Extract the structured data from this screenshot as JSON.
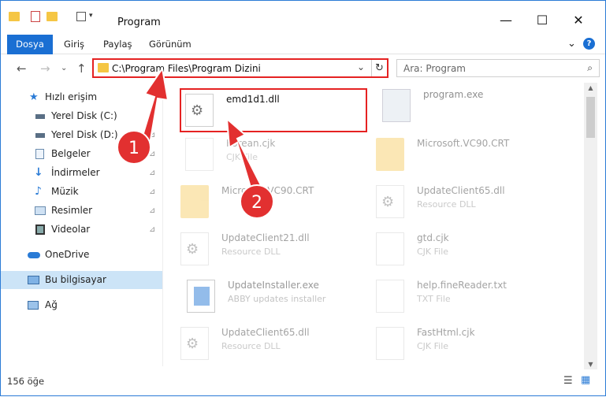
{
  "window": {
    "title": "Program",
    "minimize_glyph": "—",
    "maximize_glyph": "☐",
    "close_glyph": "✕"
  },
  "ribbon": {
    "tabs": [
      "Dosya",
      "Giriş",
      "Paylaş",
      "Görünüm"
    ],
    "expand_glyph": "⌄",
    "help_glyph": "?"
  },
  "address": {
    "path": "C:\\Program Files\\Program Dizini",
    "back_glyph": "←",
    "forward_glyph": "→",
    "recent_glyph": "⌄",
    "up_glyph": "↑",
    "dropdown_glyph": "⌄",
    "refresh_glyph": "↻"
  },
  "search": {
    "placeholder": "Ara: Program",
    "icon_glyph": "⌕"
  },
  "nav": {
    "quick_access": "Hızlı erişim",
    "items": [
      {
        "label": "Yerel Disk (C:)",
        "icon": "drive-icon"
      },
      {
        "label": "Yerel Disk (D:)",
        "icon": "drive-icon"
      },
      {
        "label": "Belgeler",
        "icon": "documents-icon"
      },
      {
        "label": "İndirmeler",
        "icon": "downloads-icon"
      },
      {
        "label": "Müzik",
        "icon": "music-icon"
      },
      {
        "label": "Resimler",
        "icon": "pictures-icon"
      },
      {
        "label": "Videolar",
        "icon": "videos-icon"
      }
    ],
    "onedrive": "OneDrive",
    "this_pc": "Bu bilgisayar",
    "network": "Ağ",
    "pin_glyph": "⊿"
  },
  "files": [
    {
      "name": "emd1d1.dll",
      "sub": "",
      "kind": "dll"
    },
    {
      "name": "program.exe",
      "sub": "",
      "kind": "exe"
    },
    {
      "name": "Korean.cjk",
      "sub": "CJK File",
      "kind": "doc"
    },
    {
      "name": "Microsoft.VC90.CRT",
      "sub": "",
      "kind": "folder"
    },
    {
      "name": "Microsoft.VC90.CRT",
      "sub": "",
      "kind": "folder"
    },
    {
      "name": "UpdateClient65.dll",
      "sub": "Resource DLL",
      "kind": "dll"
    },
    {
      "name": "UpdateClient21.dll",
      "sub": "Resource DLL",
      "kind": "dll"
    },
    {
      "name": "gtd.cjk",
      "sub": "CJK File",
      "kind": "doc"
    },
    {
      "name": "UpdateInstaller.exe",
      "sub": "ABBY updates installer",
      "kind": "exe"
    },
    {
      "name": "help.fineReader.txt",
      "sub": "TXT File",
      "kind": "doc"
    },
    {
      "name": "UpdateClient65.dll",
      "sub": "Resource DLL",
      "kind": "dll"
    },
    {
      "name": "FastHtml.cjk",
      "sub": "CJK File",
      "kind": "doc"
    }
  ],
  "scrollbar": {
    "up_glyph": "▲",
    "down_glyph": "▼"
  },
  "status": {
    "count": "156 öğe",
    "details_glyph": "☰",
    "tiles_glyph": "▦"
  },
  "annotations": {
    "callout_1": "1",
    "callout_2": "2",
    "color": "#e23030"
  }
}
